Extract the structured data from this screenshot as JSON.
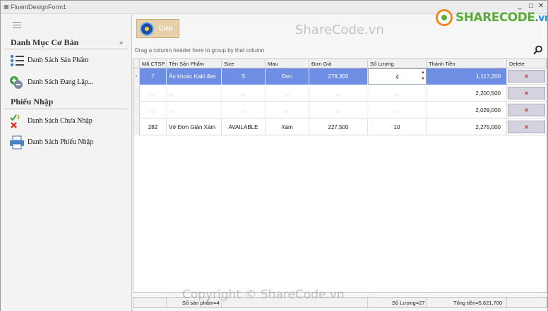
{
  "window": {
    "title": "FluentDesignForm1",
    "controls": [
      "_",
      "□",
      "✕"
    ]
  },
  "logo": {
    "brand_main": "SHARECODE",
    "brand_suffix": ".vn"
  },
  "watermarks": {
    "top": "ShareCode.vn",
    "bottom": "Copyright © ShareCode.vn"
  },
  "sidebar": {
    "groups": [
      {
        "title": "Danh Mục Cơ Bản",
        "items": [
          {
            "label": "Danh Sách Sản Phẩm",
            "icon": "list-icon"
          },
          {
            "label": "Danh Sách Đang Lập...",
            "icon": "add-remove-icon"
          }
        ]
      },
      {
        "title": "Phiếu Nhập",
        "items": [
          {
            "label": "Danh Sách Chưa Nhập",
            "icon": "check-cross-icon"
          },
          {
            "label": "Danh Sách Phiếu Nhập",
            "icon": "printer-icon"
          }
        ]
      }
    ],
    "collapse_glyph": "»"
  },
  "toolbar": {
    "save_label": "Lưu"
  },
  "grid": {
    "groupby_hint": "Drag a column header here to group by that column",
    "columns": [
      "Mã CTSP",
      "Tên Sản Phẩm",
      "Size",
      "Mau",
      "Đơn Giá",
      "Số Lượng",
      "Thành Tiền",
      "Delete"
    ],
    "rows": [
      {
        "ma": "7",
        "ten": "Áo khoác Kaki đen",
        "size": "S",
        "mau": "Đen",
        "gia": "279,300",
        "sl": "4",
        "tien": "1,117,200",
        "del": "✕",
        "blurred": false,
        "selected": true
      },
      {
        "ma": "...",
        "ten": "...",
        "size": "...",
        "mau": "...",
        "gia": "...",
        "sl": "...",
        "tien": "2,200,500",
        "del": "✕",
        "blurred": true,
        "selected": false
      },
      {
        "ma": "...",
        "ten": "...",
        "size": "...",
        "mau": "...",
        "gia": "...",
        "sl": "...",
        "tien": "2,029,000",
        "del": "✕",
        "blurred": true,
        "selected": false
      },
      {
        "ma": "282",
        "ten": "Vớ Đơn Giản Xám",
        "size": "AVAILABLE",
        "mau": "Xám",
        "gia": "227,500",
        "sl": "10",
        "tien": "2,275,000",
        "del": "✕",
        "blurred": false,
        "selected": false
      }
    ]
  },
  "footer": {
    "count_label": "Số sản phẩm=4",
    "qty_total": "Số Lượng=27",
    "money_total": "Tổng tiền=5,621,700"
  },
  "colors": {
    "selection": "#6d8ee3",
    "save_button": "#e7d0aa",
    "logo_green": "#5caa3c",
    "logo_orange": "#f08a24"
  }
}
